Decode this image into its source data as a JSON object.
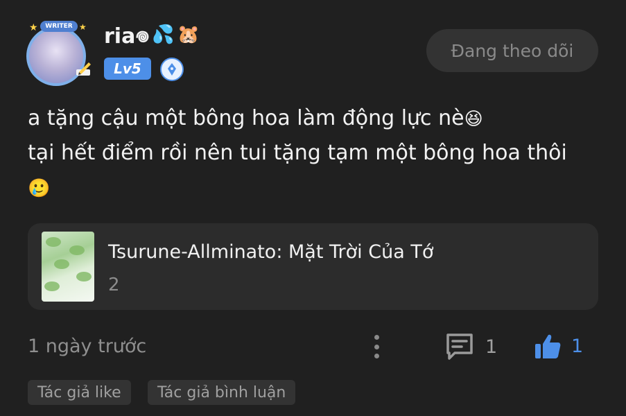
{
  "user": {
    "name": "ria𖦹",
    "name_emojis": [
      "💦",
      "🐹"
    ],
    "avatar_banner": "WRITER",
    "level": "Lv5"
  },
  "follow_button": {
    "label": "Đang theo dõi"
  },
  "comment": {
    "line1": "a tặng cậu một bông hoa làm động lực nè",
    "line1_emoji": "😆",
    "line2": "tại hết điểm rồi nên tui tặng tạm một bông hoa thôi",
    "line3_emoji": "🥲"
  },
  "story_card": {
    "title": "Tsurune-Allminato: Mặt Trời Của Tớ",
    "chapter": "2"
  },
  "footer": {
    "time": "1 ngày trước",
    "reply_count": "1",
    "like_count": "1"
  },
  "tags": [
    "Tác giả like",
    "Tác giả bình luận"
  ],
  "colors": {
    "background": "#202020",
    "accent": "#4d8fe8",
    "muted": "#8f8f8f"
  }
}
